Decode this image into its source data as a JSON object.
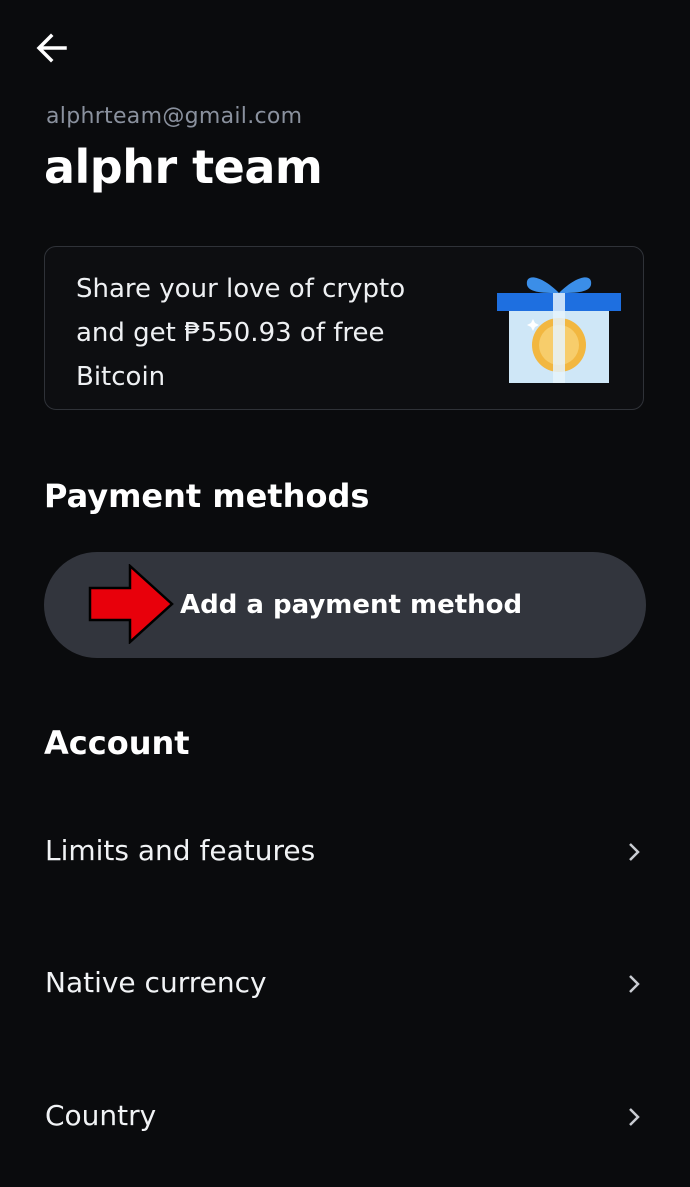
{
  "header": {
    "back_icon": "arrow-left-icon"
  },
  "profile": {
    "email": "alphrteam@gmail.com",
    "name": "alphr team"
  },
  "promo": {
    "text": "Share your love of crypto and get ₱550.93 of free Bitcoin",
    "illustration": "gift-box-icon"
  },
  "payment_methods": {
    "title": "Payment methods",
    "add_button_label": "Add a payment method",
    "annotation_icon": "red-arrow-icon"
  },
  "account": {
    "title": "Account",
    "items": [
      {
        "label": "Limits and features",
        "icon": "chevron-right-icon"
      },
      {
        "label": "Native currency",
        "icon": "chevron-right-icon"
      },
      {
        "label": "Country",
        "icon": "chevron-right-icon"
      }
    ]
  },
  "colors": {
    "background": "#0a0b0d",
    "muted_text": "#8a919e",
    "button_bg": "#32353d",
    "card_border": "#2f3238",
    "annotation_red": "#e8000b",
    "gift_blue": "#3b8ee8",
    "gift_light": "#cfe7f7",
    "coin_gold": "#f2b740"
  }
}
